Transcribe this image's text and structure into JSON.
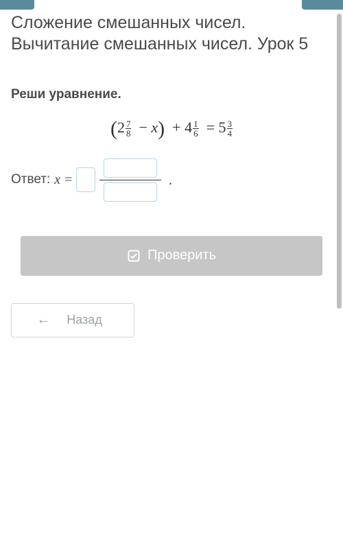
{
  "title": "Сложение смешанных чисел. Вычитание смешанных чисел. Урок 5",
  "task_prompt": "Реши уравнение.",
  "equation": {
    "var": "x",
    "a_whole": "2",
    "a_num": "7",
    "a_den": "8",
    "b_whole": "4",
    "b_num": "1",
    "b_den": "6",
    "c_whole": "5",
    "c_num": "3",
    "c_den": "4"
  },
  "answer": {
    "label": "Ответ:",
    "var": "x",
    "eq": "=",
    "whole_value": "",
    "num_value": "",
    "den_value": "",
    "period": "."
  },
  "buttons": {
    "check": "Проверить",
    "back": "Назад"
  }
}
